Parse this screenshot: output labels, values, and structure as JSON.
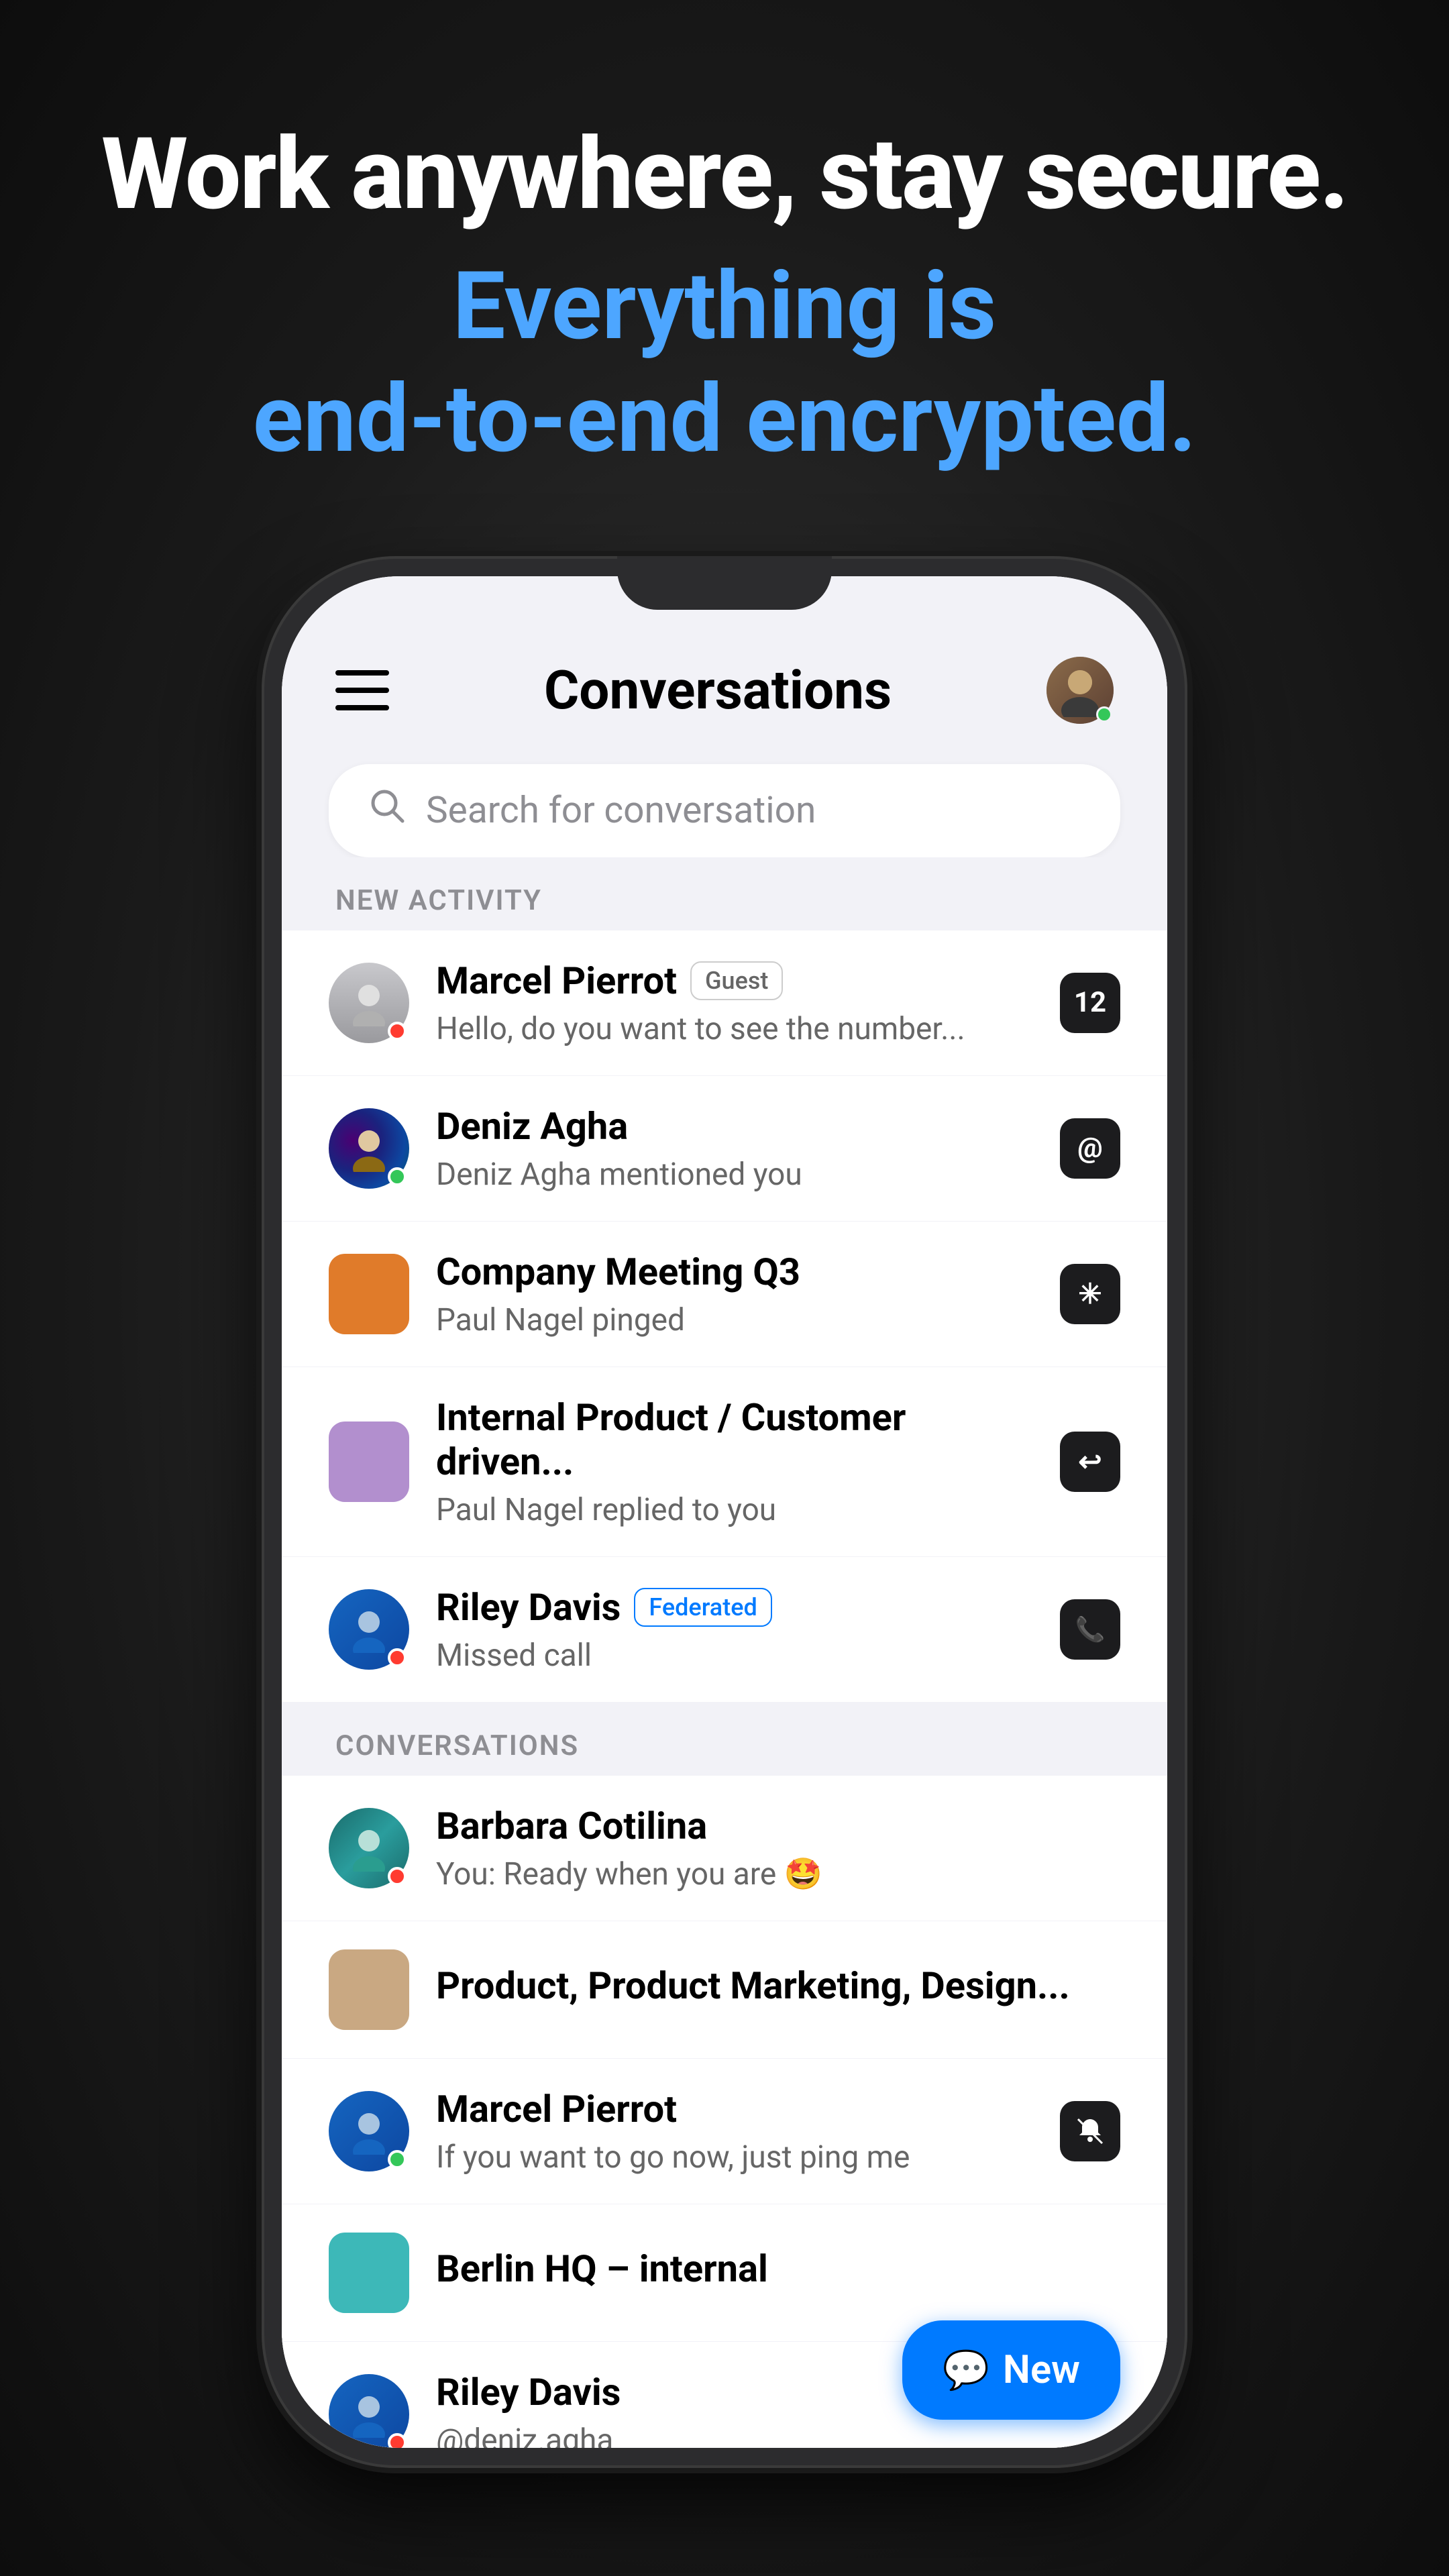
{
  "headline": {
    "main": "Work anywhere, stay secure.",
    "sub_line1": "Everything is",
    "sub_line2": "end-to-end encrypted."
  },
  "header": {
    "title": "Conversations"
  },
  "search": {
    "placeholder": "Search for conversation"
  },
  "new_activity_section": {
    "label": "NEW ACTIVITY",
    "items": [
      {
        "id": 1,
        "name": "Marcel Pierrot",
        "badge": "Guest",
        "badge_type": "guest",
        "preview": "Hello, do you want to see the number...",
        "badge_count": "12",
        "avatar_type": "person",
        "avatar_color": "person-1",
        "status": "busy"
      },
      {
        "id": 2,
        "name": "Deniz Agha",
        "badge": null,
        "preview": "Deniz Agha mentioned you",
        "badge_count": null,
        "badge_icon": "mention",
        "avatar_type": "person",
        "avatar_color": "deniz",
        "status": "online"
      },
      {
        "id": 3,
        "name": "Company Meeting Q3",
        "badge": null,
        "preview": "Paul Nagel pinged",
        "badge_icon": "star",
        "avatar_type": "square",
        "avatar_color": "#e07b2a",
        "status": null
      },
      {
        "id": 4,
        "name": "Internal Product / Customer driven...",
        "badge": null,
        "preview": "Paul Nagel replied to you",
        "badge_icon": "reply",
        "avatar_type": "square",
        "avatar_color": "#b28fce",
        "status": null
      },
      {
        "id": 5,
        "name": "Riley Davis",
        "badge": "Federated",
        "badge_type": "federated",
        "preview": "Missed call",
        "badge_icon": "call",
        "avatar_type": "person",
        "avatar_color": "riley",
        "status": "busy"
      }
    ]
  },
  "conversations_section": {
    "label": "CONVERSATIONS",
    "items": [
      {
        "id": 6,
        "name": "Barbara Cotilina",
        "badge": null,
        "preview": "You: Ready when you are 🤩",
        "badge_icon": null,
        "avatar_type": "person",
        "avatar_color": "barbara",
        "status": "busy"
      },
      {
        "id": 7,
        "name": "Product, Product Marketing, Design...",
        "badge": null,
        "preview": "",
        "badge_icon": null,
        "avatar_type": "square",
        "avatar_color": "#c9a882",
        "status": null
      },
      {
        "id": 8,
        "name": "Marcel Pierrot",
        "badge": null,
        "preview": "If you want to go now, just ping me",
        "badge_icon": "mute",
        "avatar_type": "person",
        "avatar_color": "marcel2",
        "status": "online"
      },
      {
        "id": 9,
        "name": "Berlin HQ – internal",
        "badge": null,
        "preview": "",
        "badge_icon": null,
        "avatar_type": "square",
        "avatar_color": "#3db8b8",
        "status": null
      },
      {
        "id": 10,
        "name": "Riley Davis",
        "badge": null,
        "preview": "@deniz.agha",
        "badge_icon": null,
        "avatar_type": "person",
        "avatar_color": "riley",
        "status": "busy"
      }
    ]
  },
  "fab": {
    "label": "New",
    "icon": "💬"
  },
  "colors": {
    "accent_blue": "#007aff",
    "online_green": "#34c759",
    "busy_red": "#ff3b30",
    "away_orange": "#ff9500",
    "dark_badge": "#1c1c1e"
  }
}
